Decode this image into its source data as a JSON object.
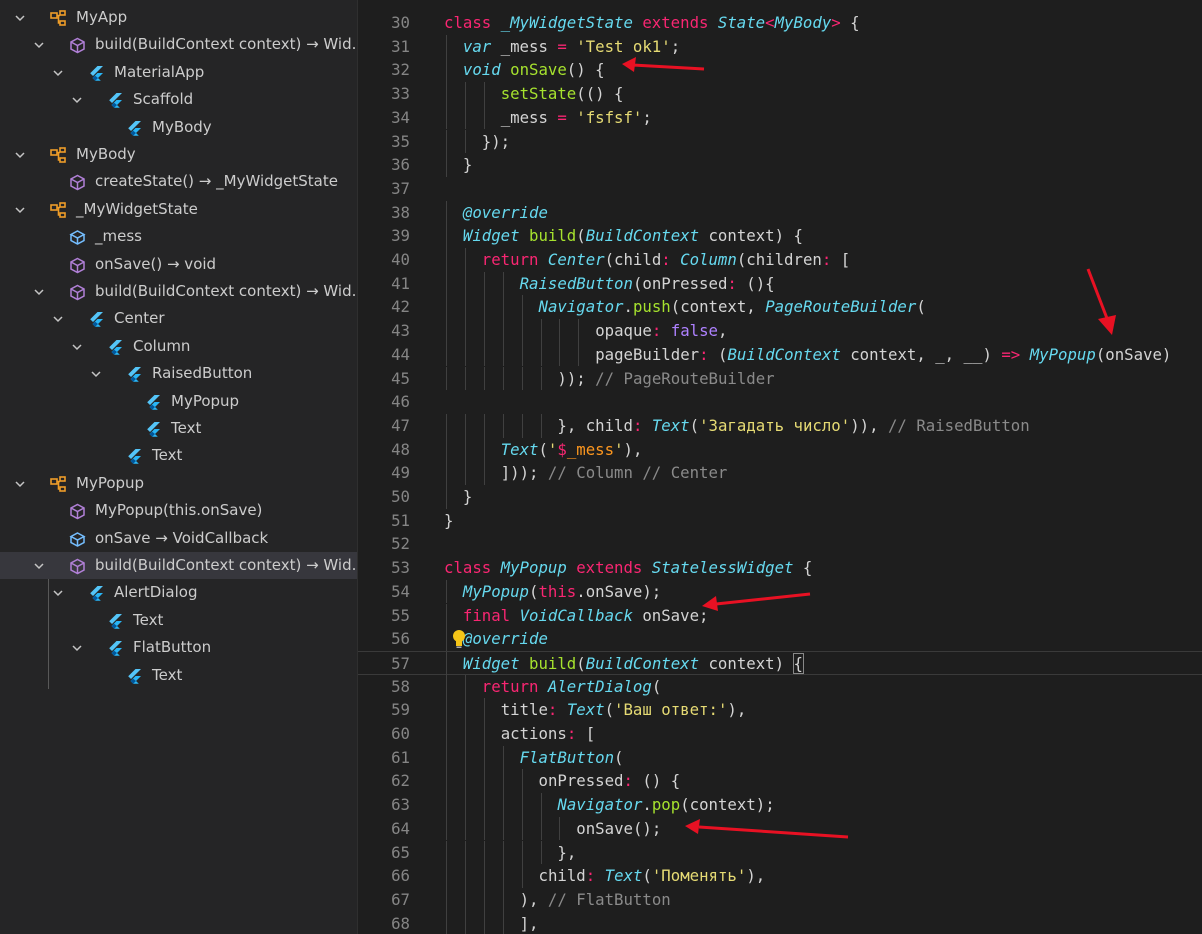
{
  "outline": {
    "items": [
      {
        "label": "MyApp",
        "icon": "class-icon",
        "chevron": "down",
        "depth": 0
      },
      {
        "label": "build(BuildContext context) → Wid...",
        "icon": "method-icon",
        "chevron": "down",
        "depth": 1
      },
      {
        "label": "MaterialApp",
        "icon": "flutter-widget-icon",
        "chevron": "down",
        "depth": 2
      },
      {
        "label": "Scaffold",
        "icon": "flutter-widget-icon",
        "chevron": "down",
        "depth": 3
      },
      {
        "label": "MyBody",
        "icon": "flutter-widget-icon",
        "chevron": "none",
        "depth": 4
      },
      {
        "label": "MyBody",
        "icon": "class-icon",
        "chevron": "down",
        "depth": 0
      },
      {
        "label": "createState() → _MyWidgetState",
        "icon": "method-icon",
        "chevron": "none",
        "depth": 1
      },
      {
        "label": "_MyWidgetState",
        "icon": "class-icon",
        "chevron": "down",
        "depth": 0
      },
      {
        "label": "_mess",
        "icon": "field-icon",
        "chevron": "none",
        "depth": 1
      },
      {
        "label": "onSave() → void",
        "icon": "method-icon",
        "chevron": "none",
        "depth": 1
      },
      {
        "label": "build(BuildContext context) → Wid...",
        "icon": "method-icon",
        "chevron": "down",
        "depth": 1
      },
      {
        "label": "Center",
        "icon": "flutter-widget-icon",
        "chevron": "down",
        "depth": 2
      },
      {
        "label": "Column",
        "icon": "flutter-widget-icon",
        "chevron": "down",
        "depth": 3
      },
      {
        "label": "RaisedButton",
        "icon": "flutter-widget-icon",
        "chevron": "down",
        "depth": 4
      },
      {
        "label": "MyPopup",
        "icon": "flutter-widget-icon",
        "chevron": "none",
        "depth": 5
      },
      {
        "label": "Text",
        "icon": "flutter-widget-icon",
        "chevron": "none",
        "depth": 5
      },
      {
        "label": "Text",
        "icon": "flutter-widget-icon",
        "chevron": "none",
        "depth": 4
      },
      {
        "label": "MyPopup",
        "icon": "class-icon",
        "chevron": "down",
        "depth": 0
      },
      {
        "label": "MyPopup(this.onSave)",
        "icon": "method-icon",
        "chevron": "none",
        "depth": 1
      },
      {
        "label": "onSave → VoidCallback",
        "icon": "field-icon",
        "chevron": "none",
        "depth": 1
      },
      {
        "label": "build(BuildContext context) → Wid...",
        "icon": "method-icon",
        "chevron": "down",
        "depth": 1,
        "selected": true
      },
      {
        "label": "AlertDialog",
        "icon": "flutter-widget-icon",
        "chevron": "down",
        "depth": 2
      },
      {
        "label": "Text",
        "icon": "flutter-widget-icon",
        "chevron": "none",
        "depth": 3
      },
      {
        "label": "FlatButton",
        "icon": "flutter-widget-icon",
        "chevron": "down",
        "depth": 3
      },
      {
        "label": "Text",
        "icon": "flutter-widget-icon",
        "chevron": "none",
        "depth": 4
      }
    ]
  },
  "editor": {
    "current_line": 57,
    "lines": [
      {
        "n": "30",
        "indent": 0,
        "tokens": [
          [
            "kw",
            "class "
          ],
          [
            "t",
            "_MyWidgetState "
          ],
          [
            "kw",
            "extends "
          ],
          [
            "t",
            "State"
          ],
          [
            "kw",
            "<"
          ],
          [
            "t",
            "MyBody"
          ],
          [
            "kw",
            "> "
          ],
          [
            "p",
            "{"
          ]
        ]
      },
      {
        "n": "31",
        "indent": 1,
        "tokens": [
          [
            "t",
            "var "
          ],
          [
            "p",
            "_mess "
          ],
          [
            "kw",
            "= "
          ],
          [
            "s",
            "'Test ok1'"
          ],
          [
            "p",
            ";"
          ]
        ]
      },
      {
        "n": "32",
        "indent": 1,
        "tokens": [
          [
            "t",
            "void "
          ],
          [
            "f",
            "onSave"
          ],
          [
            "p",
            "() {"
          ]
        ]
      },
      {
        "n": "33",
        "indent": 3,
        "tokens": [
          [
            "f",
            "setState"
          ],
          [
            "p",
            "(() {"
          ]
        ]
      },
      {
        "n": "34",
        "indent": 3,
        "tokens": [
          [
            "p",
            "_mess "
          ],
          [
            "kw",
            "= "
          ],
          [
            "s",
            "'fsfsf'"
          ],
          [
            "p",
            ";"
          ]
        ]
      },
      {
        "n": "35",
        "indent": 2,
        "tokens": [
          [
            "p",
            "});"
          ]
        ]
      },
      {
        "n": "36",
        "indent": 1,
        "tokens": [
          [
            "p",
            "}"
          ]
        ]
      },
      {
        "n": "37",
        "indent": 0,
        "tokens": []
      },
      {
        "n": "38",
        "indent": 1,
        "tokens": [
          [
            "t",
            "@override"
          ]
        ]
      },
      {
        "n": "39",
        "indent": 1,
        "tokens": [
          [
            "t",
            "Widget "
          ],
          [
            "f",
            "build"
          ],
          [
            "p",
            "("
          ],
          [
            "t",
            "BuildContext "
          ],
          [
            "p",
            "context) {"
          ]
        ]
      },
      {
        "n": "40",
        "indent": 2,
        "tokens": [
          [
            "kw",
            "return "
          ],
          [
            "t",
            "Center"
          ],
          [
            "p",
            "(child"
          ],
          [
            "kw",
            ": "
          ],
          [
            "t",
            "Column"
          ],
          [
            "p",
            "(children"
          ],
          [
            "kw",
            ": "
          ],
          [
            "p",
            "["
          ]
        ]
      },
      {
        "n": "41",
        "indent": 4,
        "tokens": [
          [
            "t",
            "RaisedButton"
          ],
          [
            "p",
            "(onPressed"
          ],
          [
            "kw",
            ": "
          ],
          [
            "p",
            "(){"
          ]
        ]
      },
      {
        "n": "42",
        "indent": 5,
        "tokens": [
          [
            "t",
            "Navigator"
          ],
          [
            "p",
            "."
          ],
          [
            "f",
            "push"
          ],
          [
            "p",
            "(context, "
          ],
          [
            "t",
            "PageRouteBuilder"
          ],
          [
            "p",
            "("
          ]
        ]
      },
      {
        "n": "43",
        "indent": 8,
        "tokens": [
          [
            "p",
            "opaque"
          ],
          [
            "kw",
            ": "
          ],
          [
            "pu",
            "false"
          ],
          [
            "p",
            ","
          ]
        ]
      },
      {
        "n": "44",
        "indent": 8,
        "tokens": [
          [
            "p",
            "pageBuilder"
          ],
          [
            "kw",
            ": "
          ],
          [
            "p",
            "("
          ],
          [
            "t",
            "BuildContext "
          ],
          [
            "p",
            "context, _, __) "
          ],
          [
            "kw",
            "=> "
          ],
          [
            "t",
            "MyPopup"
          ],
          [
            "p",
            "(onSave)"
          ]
        ]
      },
      {
        "n": "45",
        "indent": 6,
        "tokens": [
          [
            "p",
            "));"
          ],
          [
            "c",
            " // PageRouteBuilder"
          ]
        ]
      },
      {
        "n": "46",
        "indent": 0,
        "tokens": []
      },
      {
        "n": "47",
        "indent": 6,
        "tokens": [
          [
            "p",
            "}, child"
          ],
          [
            "kw",
            ": "
          ],
          [
            "t",
            "Text"
          ],
          [
            "p",
            "("
          ],
          [
            "s",
            "'Загадать число'"
          ],
          [
            "p",
            "))"
          ],
          [
            "p",
            ", "
          ],
          [
            "c",
            "// RaisedButton"
          ]
        ]
      },
      {
        "n": "48",
        "indent": 3,
        "tokens": [
          [
            "t",
            "Text"
          ],
          [
            "p",
            "("
          ],
          [
            "s",
            "'"
          ],
          [
            "a",
            "$"
          ],
          [
            "or",
            "_mess"
          ],
          [
            "s",
            "'"
          ],
          [
            "p",
            "),"
          ]
        ]
      },
      {
        "n": "49",
        "indent": 3,
        "tokens": [
          [
            "p",
            "]));"
          ],
          [
            "c",
            " // Column // Center"
          ]
        ]
      },
      {
        "n": "50",
        "indent": 1,
        "tokens": [
          [
            "p",
            "}"
          ]
        ]
      },
      {
        "n": "51",
        "indent": 0,
        "tokens": [
          [
            "p",
            "}"
          ]
        ]
      },
      {
        "n": "52",
        "indent": 0,
        "tokens": []
      },
      {
        "n": "53",
        "indent": 0,
        "tokens": [
          [
            "kw",
            "class "
          ],
          [
            "t",
            "MyPopup "
          ],
          [
            "kw",
            "extends "
          ],
          [
            "t",
            "StatelessWidget "
          ],
          [
            "p",
            "{"
          ]
        ]
      },
      {
        "n": "54",
        "indent": 1,
        "tokens": [
          [
            "t",
            "MyPopup"
          ],
          [
            "p",
            "("
          ],
          [
            "kw",
            "this"
          ],
          [
            "p",
            ".onSave);"
          ]
        ]
      },
      {
        "n": "55",
        "indent": 1,
        "tokens": [
          [
            "kw",
            "final "
          ],
          [
            "t",
            "VoidCallback "
          ],
          [
            "p",
            "onSave;"
          ]
        ]
      },
      {
        "n": "56",
        "indent": 1,
        "tokens": [
          [
            "t",
            "@override"
          ]
        ]
      },
      {
        "n": "57",
        "indent": 1,
        "tokens": [
          [
            "t",
            "Widget "
          ],
          [
            "f",
            "build"
          ],
          [
            "p",
            "("
          ],
          [
            "t",
            "BuildContext "
          ],
          [
            "p",
            "context) "
          ],
          [
            "p",
            "{"
          ]
        ]
      },
      {
        "n": "58",
        "indent": 2,
        "tokens": [
          [
            "kw",
            "return "
          ],
          [
            "t",
            "AlertDialog"
          ],
          [
            "p",
            "("
          ]
        ]
      },
      {
        "n": "59",
        "indent": 3,
        "tokens": [
          [
            "p",
            "title"
          ],
          [
            "kw",
            ": "
          ],
          [
            "t",
            "Text"
          ],
          [
            "p",
            "("
          ],
          [
            "s",
            "'Ваш ответ:'"
          ],
          [
            "p",
            "),"
          ]
        ]
      },
      {
        "n": "60",
        "indent": 3,
        "tokens": [
          [
            "p",
            "actions"
          ],
          [
            "kw",
            ": "
          ],
          [
            "p",
            "["
          ]
        ]
      },
      {
        "n": "61",
        "indent": 4,
        "tokens": [
          [
            "t",
            "FlatButton"
          ],
          [
            "p",
            "("
          ]
        ]
      },
      {
        "n": "62",
        "indent": 5,
        "tokens": [
          [
            "p",
            "onPressed"
          ],
          [
            "kw",
            ": "
          ],
          [
            "p",
            "() {"
          ]
        ]
      },
      {
        "n": "63",
        "indent": 6,
        "tokens": [
          [
            "t",
            "Navigator"
          ],
          [
            "p",
            "."
          ],
          [
            "f",
            "pop"
          ],
          [
            "p",
            "(context);"
          ]
        ]
      },
      {
        "n": "64",
        "indent": 7,
        "tokens": [
          [
            "p",
            "onSave();"
          ]
        ]
      },
      {
        "n": "65",
        "indent": 6,
        "tokens": [
          [
            "p",
            "},"
          ]
        ]
      },
      {
        "n": "66",
        "indent": 5,
        "tokens": [
          [
            "p",
            "child"
          ],
          [
            "kw",
            ": "
          ],
          [
            "t",
            "Text"
          ],
          [
            "p",
            "("
          ],
          [
            "s",
            "'Поменять'"
          ],
          [
            "p",
            "),"
          ]
        ]
      },
      {
        "n": "67",
        "indent": 4,
        "tokens": [
          [
            "p",
            "),"
          ],
          [
            "c",
            " // FlatButton"
          ]
        ]
      },
      {
        "n": "68",
        "indent": 4,
        "tokens": [
          [
            "p",
            "],"
          ]
        ]
      }
    ]
  },
  "colors": {
    "annotation_arrow": "#e81123",
    "selection": "#37373d",
    "bulb": "#f5c518"
  }
}
